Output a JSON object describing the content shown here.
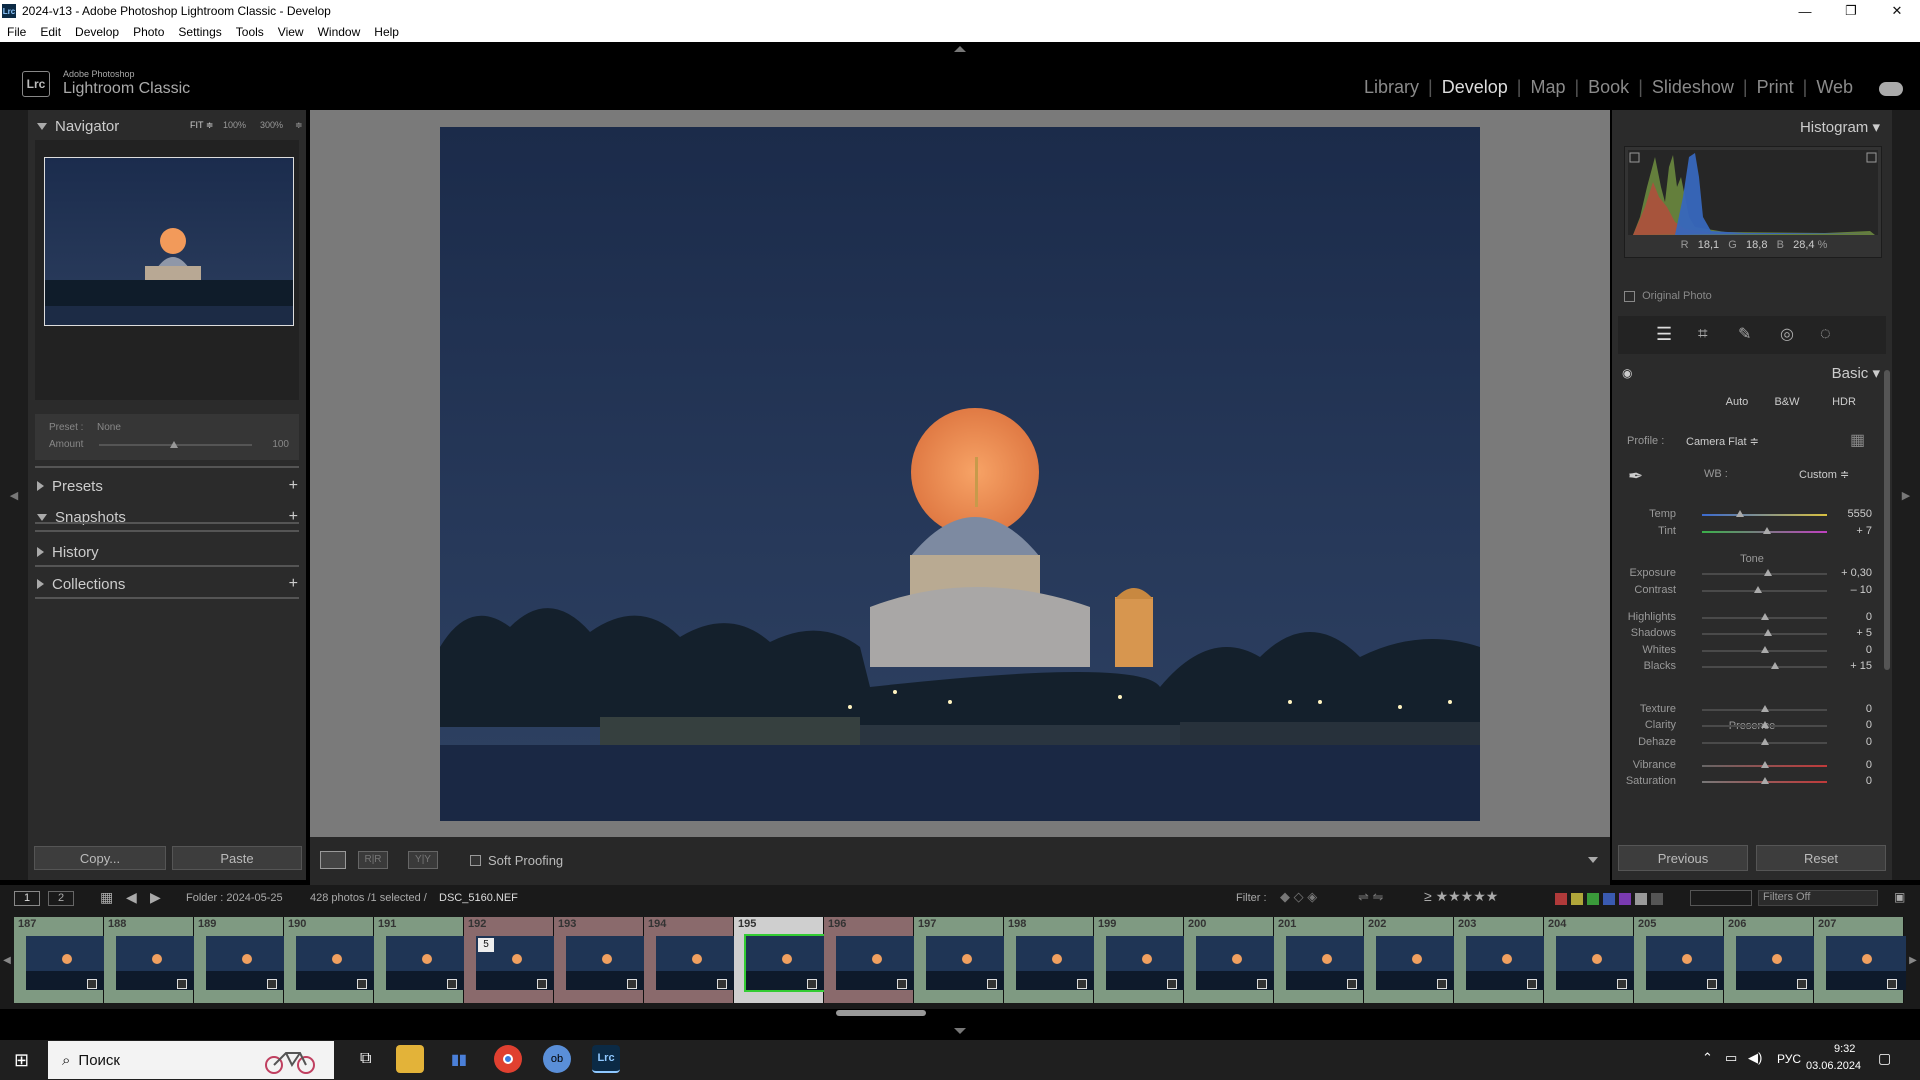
{
  "window": {
    "app_icon": "Lrc",
    "title": "2024-v13 - Adobe Photoshop Lightroom Classic - Develop",
    "controls": [
      "—",
      "❐",
      "✕"
    ]
  },
  "menu": [
    "File",
    "Edit",
    "Develop",
    "Photo",
    "Settings",
    "Tools",
    "View",
    "Window",
    "Help"
  ],
  "brand": {
    "logo": "Lrc",
    "line1": "Adobe Photoshop",
    "line2": "Lightroom Classic"
  },
  "modules": [
    "Library",
    "Develop",
    "Map",
    "Book",
    "Slideshow",
    "Print",
    "Web"
  ],
  "active_module": "Develop",
  "navigator": {
    "title": "Navigator",
    "zoom_fit": "FIT ≑",
    "zoom_100": "100%",
    "zoom_300": "300%",
    "zoom_more": "≑"
  },
  "preset_box": {
    "preset_label": "Preset :",
    "preset_value": "None",
    "amount_label": "Amount",
    "amount_value": "100"
  },
  "left_sections": [
    {
      "label": "Presets",
      "expanded": false,
      "plus": "+"
    },
    {
      "label": "Snapshots",
      "expanded": true,
      "plus": "+"
    },
    {
      "label": "History",
      "expanded": false,
      "plus": ""
    },
    {
      "label": "Collections",
      "expanded": false,
      "plus": "+"
    }
  ],
  "left_buttons": {
    "copy": "Copy...",
    "paste": "Paste"
  },
  "toolbar": {
    "soft_proofing": "Soft Proofing",
    "view_yy": "Y|Y",
    "view_rr": "R|R"
  },
  "histogram": {
    "title": "Histogram",
    "r_label": "R",
    "r_value": "18,1",
    "g_label": "G",
    "g_value": "18,8",
    "b_label": "B",
    "b_value": "28,4",
    "unit": "%",
    "original_photo": "Original Photo"
  },
  "basic": {
    "title": "Basic",
    "auto": "Auto",
    "bw": "B&W",
    "hdr": "HDR",
    "profile_label": "Profile :",
    "profile_value": "Camera Flat ≑",
    "wb_label": "WB :",
    "wb_value": "Custom ≑",
    "tone_label": "Tone",
    "presence_label": "Presence",
    "sliders": [
      {
        "label": "Temp",
        "value": "5550",
        "pos": 0.3
      },
      {
        "label": "Tint",
        "value": "+ 7",
        "pos": 0.52
      },
      {
        "label": "Exposure",
        "value": "+ 0,30",
        "pos": 0.53
      },
      {
        "label": "Contrast",
        "value": "– 10",
        "pos": 0.45
      },
      {
        "label": "Highlights",
        "value": "0",
        "pos": 0.5
      },
      {
        "label": "Shadows",
        "value": "+ 5",
        "pos": 0.53
      },
      {
        "label": "Whites",
        "value": "0",
        "pos": 0.5
      },
      {
        "label": "Blacks",
        "value": "+ 15",
        "pos": 0.58
      },
      {
        "label": "Texture",
        "value": "0",
        "pos": 0.5
      },
      {
        "label": "Clarity",
        "value": "0",
        "pos": 0.5
      },
      {
        "label": "Dehaze",
        "value": "0",
        "pos": 0.5
      },
      {
        "label": "Vibrance",
        "value": "0",
        "pos": 0.5
      },
      {
        "label": "Saturation",
        "value": "0",
        "pos": 0.5
      }
    ]
  },
  "right_buttons": {
    "previous": "Previous",
    "reset": "Reset"
  },
  "filmbar": {
    "page1": "1",
    "page2": "2",
    "folder": "Folder : 2024-05-25",
    "count": "428 photos /1 selected /",
    "filename": "DSC_5160.NEF",
    "filter_label": "Filter :",
    "filters_off": "Filters Off"
  },
  "filmstrip": {
    "numbers": [
      "187",
      "188",
      "189",
      "190",
      "191",
      "192",
      "193",
      "194",
      "195",
      "196",
      "197",
      "198",
      "199",
      "200",
      "201",
      "202",
      "203",
      "204",
      "205",
      "206",
      "207"
    ],
    "stack_badge": "5",
    "selected": "195"
  },
  "taskbar": {
    "search_placeholder": "Поиск",
    "language": "РУС",
    "time": "9:32",
    "date": "03.06.2024"
  }
}
